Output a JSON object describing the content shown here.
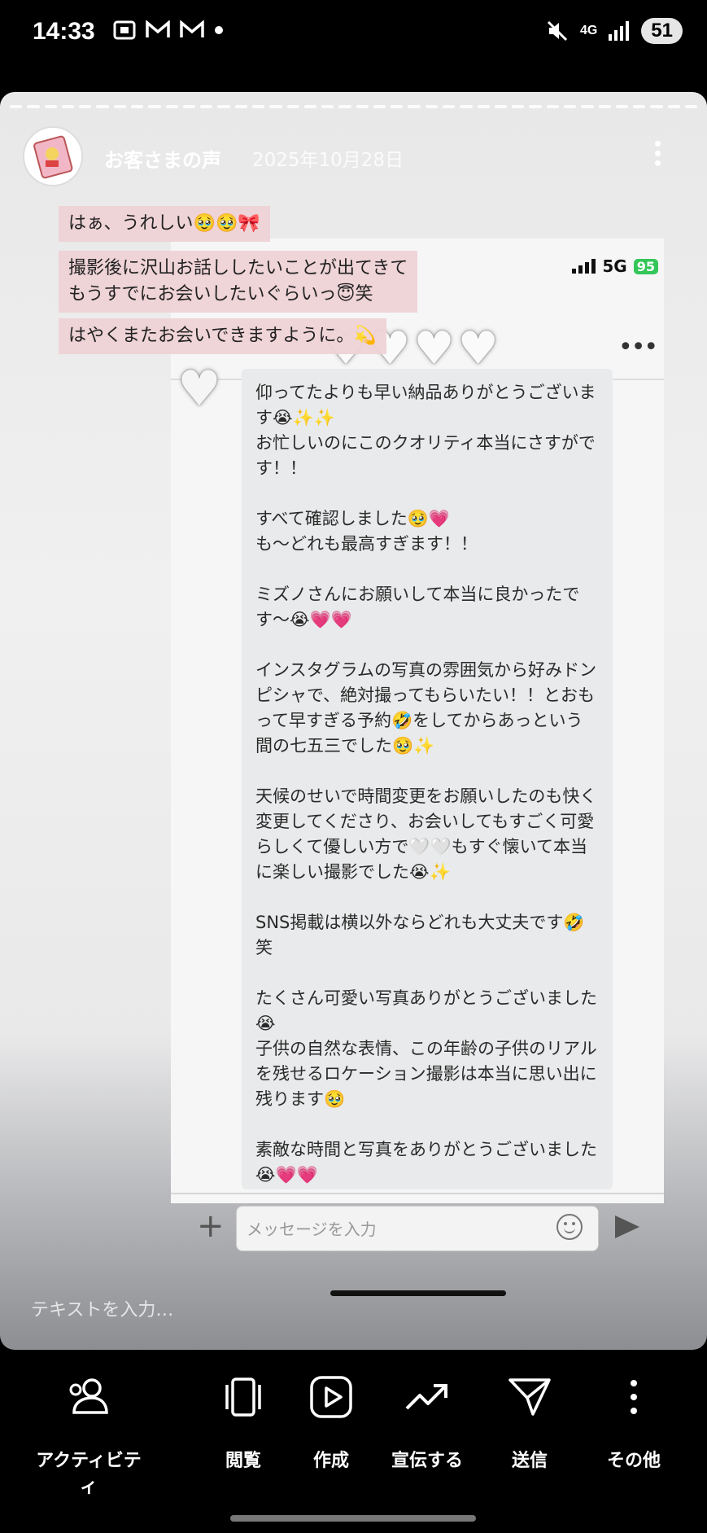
{
  "status_bar": {
    "time": "14:33",
    "signal_label": "4G",
    "battery": "51"
  },
  "story": {
    "account_name": "お客さまの声",
    "date": "2025年10月28日",
    "captions": [
      "はぁ、うれしい🥹🥹🎀",
      "撮影後に沢山お話ししたいことが出てきて\nもうすでにお会いしたいぐらいっ😇笑",
      "はやくまたお会いできますように。💫"
    ],
    "text_input_placeholder": "テキストを入力…"
  },
  "screenshot": {
    "network": "5G",
    "battery": "95",
    "message_text": "仰ってたよりも早い納品ありがとうございます😭✨✨\nお忙しいのにこのクオリティ本当にさすがです！！\n\nすべて確認しました🥹💗\nも〜どれも最高すぎます！！\n\nミズノさんにお願いして本当に良かったです〜😭💗💗\n\nインスタグラムの写真の雰囲気から好みドンピシャで、絶対撮ってもらいたい！！とおもって早すぎる予約🤣をしてからあっという間の七五三でした🥹✨\n\n天候のせいで時間変更をお願いしたのも快く変更してくださり、お会いしてもすごく可愛らしくて優しい方で🤍🤍もすぐ懐いて本当に楽しい撮影でした😭✨\n\nSNS掲載は横以外ならどれも大丈夫です🤣笑\n\nたくさん可愛い写真ありがとうございました😭\n子供の自然な表情、この年齢の子供のリアルを残せるロケーション撮影は本当に思い出に残ります🥹\n\n素敵な時間と写真をありがとうございました😭💗💗",
    "input_placeholder": "メッセージを入力"
  },
  "bottom_bar": {
    "items": [
      {
        "label": "アクティビティ",
        "icon": "activity-icon"
      },
      {
        "label": "閲覧",
        "icon": "view-icon"
      },
      {
        "label": "作成",
        "icon": "create-icon"
      },
      {
        "label": "宣伝する",
        "icon": "promote-icon"
      },
      {
        "label": "送信",
        "icon": "send-icon"
      },
      {
        "label": "その他",
        "icon": "more-icon"
      }
    ]
  }
}
